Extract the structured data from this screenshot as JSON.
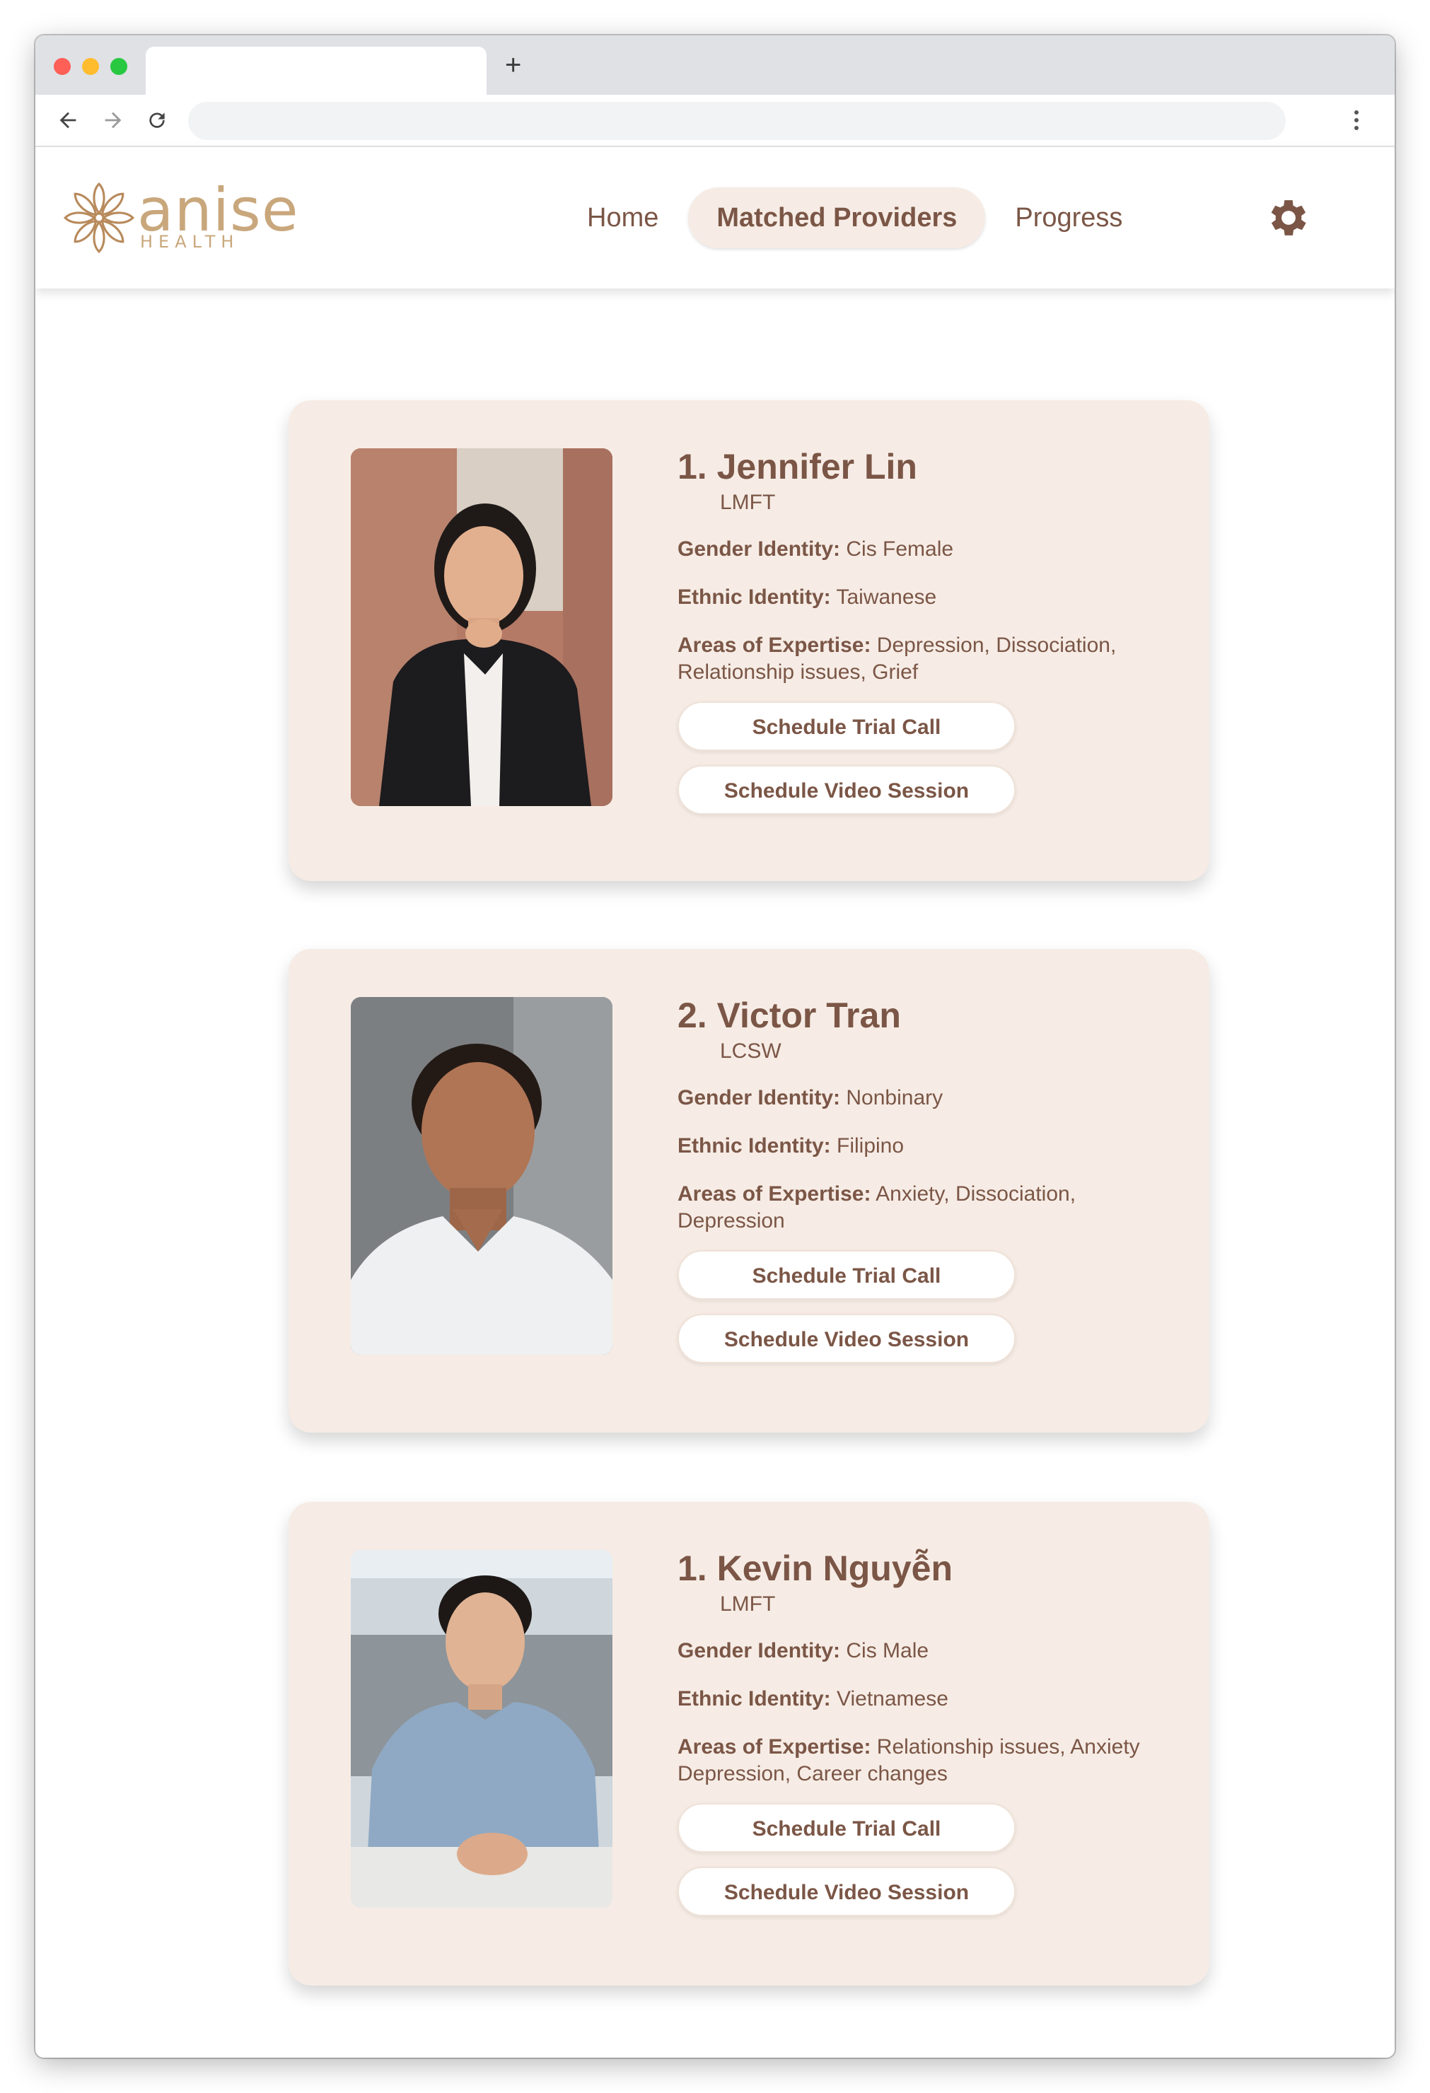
{
  "browser": {
    "new_tab_label": "+"
  },
  "app": {
    "logo": {
      "word": "anise",
      "sub": "HEALTH"
    },
    "nav": [
      {
        "label": "Home"
      },
      {
        "label": "Matched Providers"
      },
      {
        "label": "Progress"
      }
    ],
    "active_nav": "Matched Providers",
    "accent_color": "#7b5646",
    "card_color": "#f6ece5"
  },
  "labels": {
    "gender": "Gender Identity:",
    "ethnic": "Ethnic Identity:",
    "expertise": "Areas of Expertise:"
  },
  "providers": [
    {
      "name": "1. Jennifer Lin",
      "credential": "LMFT",
      "gender": "Cis Female",
      "ethnicity": "Taiwanese",
      "expertise_line1": "Depression, Dissociation,",
      "expertise_line2": "Relationship issues, Grief",
      "trial_button": "Schedule Trial Call",
      "video_button": "Schedule Video Session"
    },
    {
      "name": "2. Victor Tran",
      "credential": "LCSW",
      "gender": "Nonbinary",
      "ethnicity": "Filipino",
      "expertise_line1": "Anxiety, Dissociation,",
      "expertise_line2": "Depression",
      "trial_button": "Schedule Trial Call",
      "video_button": "Schedule Video Session"
    },
    {
      "name": "1. Kevin Nguyễn",
      "credential": "LMFT",
      "gender": "Cis Male",
      "ethnicity": "Vietnamese",
      "expertise_line1": "Relationship issues, Anxiety",
      "expertise_line2": "Depression, Career changes",
      "trial_button": "Schedule Trial Call",
      "video_button": "Schedule Video Session"
    }
  ]
}
